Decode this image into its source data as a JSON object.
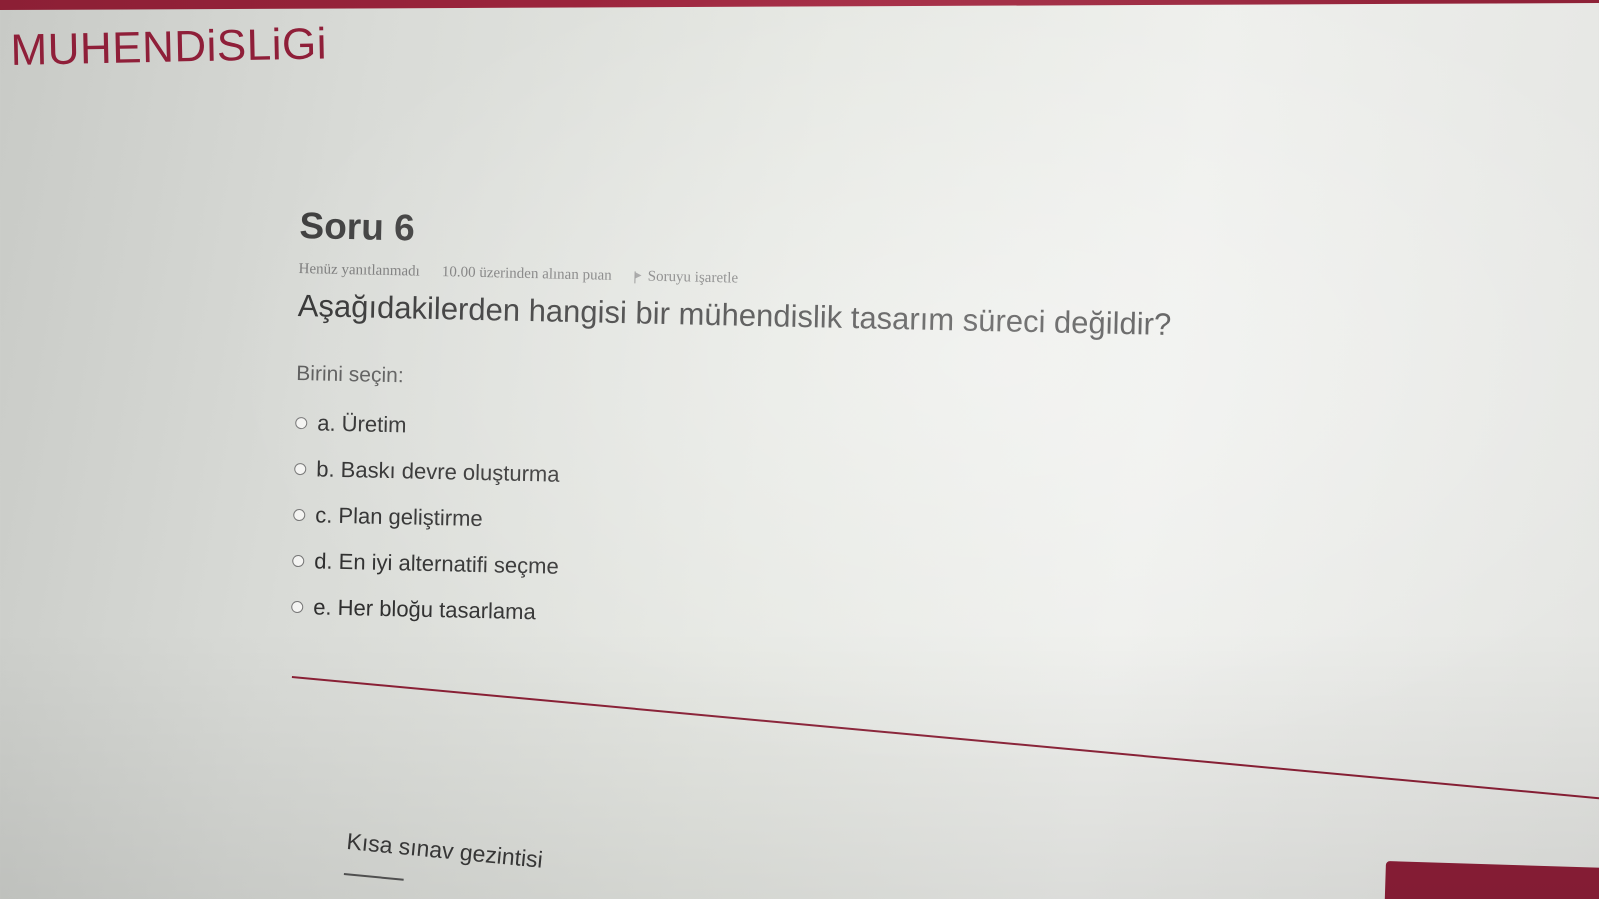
{
  "site": {
    "title": "MUHENDiSLiGi",
    "accent_color": "#8e1e38"
  },
  "question": {
    "number_label": "Soru 6",
    "status": "Henüz yanıtlanmadı",
    "points": "10.00 üzerinden alınan puan",
    "flag_label": "Soruyu işaretle",
    "flag_icon": "flag-icon",
    "text": "Aşağıdakilerden hangisi bir mühendislik tasarım süreci değildir?",
    "choose_label": "Birini seçin:",
    "options": [
      {
        "label": "a. Üretim",
        "selected": false
      },
      {
        "label": "b. Baskı devre oluşturma",
        "selected": false
      },
      {
        "label": "c. Plan geliştirme",
        "selected": false
      },
      {
        "label": "d. En iyi alternatifi seçme",
        "selected": false
      },
      {
        "label": "e. Her bloğu tasarlama",
        "selected": false
      }
    ]
  },
  "navigation": {
    "title": "Kısa sınav gezintisi"
  }
}
